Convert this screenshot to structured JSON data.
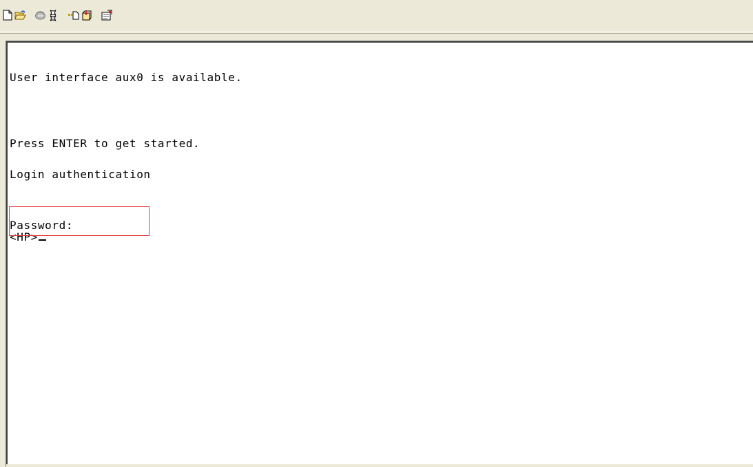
{
  "toolbar": {
    "buttons": [
      {
        "icon": "new-document-icon"
      },
      {
        "icon": "open-folder-icon"
      },
      {
        "icon": "connect-phone-icon"
      },
      {
        "icon": "disconnect-icon"
      },
      {
        "icon": "send-file-icon"
      },
      {
        "icon": "receive-file-icon"
      },
      {
        "icon": "properties-icon"
      }
    ]
  },
  "terminal": {
    "line1": "User interface aux0 is available.",
    "line2": "Press ENTER to get started.",
    "line3": "Login authentication",
    "line4": "Password:",
    "line5": "<HP>"
  },
  "colors": {
    "toolbar_bg": "#ece9d8",
    "terminal_bg": "#ffffff",
    "highlight_border": "#e23b3b"
  }
}
